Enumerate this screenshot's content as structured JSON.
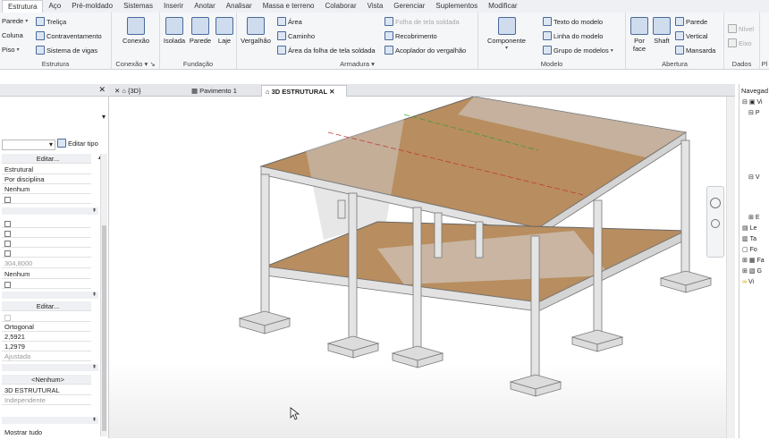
{
  "menu_tabs": [
    "Estrutura",
    "Aço",
    "Pré-moldado",
    "Sistemas",
    "Inserir",
    "Anotar",
    "Analisar",
    "Massa e terreno",
    "Colaborar",
    "Vista",
    "Gerenciar",
    "Suplementos",
    "Modificar"
  ],
  "ribbon": {
    "estrutura": {
      "label": "Estrutura",
      "parede": "Parede",
      "trelica": "Treliça",
      "coluna": "Coluna",
      "contraventamento": "Contraventamento",
      "piso": "Piso",
      "sistema_vigas": "Sistema de vigas"
    },
    "conexao": {
      "label": "Conexão",
      "btn": "Conexão"
    },
    "fundacao": {
      "label": "Fundação",
      "isolada": "Isolada",
      "parede": "Parede",
      "laje": "Laje"
    },
    "armadura": {
      "label": "Armadura",
      "vergalhao": "Vergalhão",
      "area": "Área",
      "caminho": "Caminho",
      "area_folha": "Área  da folha de tela soldada",
      "folha_tela": "Folha de tela soldada",
      "recobrimento": "Recobrimento",
      "acoplador": "Acoplador do  vergalhão"
    },
    "modelo": {
      "label": "Modelo",
      "componente": "Componente",
      "texto_modelo": "Texto do modelo",
      "linha_modelo": "Linha do modelo",
      "grupo_modelos": "Grupo de modelos"
    },
    "abertura": {
      "label": "Abertura",
      "por_face": "Por face",
      "shaft": "Shaft",
      "parede": "Parede",
      "vertical": "Vertical",
      "mansarda": "Mansarda"
    },
    "dados": {
      "label": "Dados",
      "nivel": "Nível",
      "eixo": "Eixo"
    },
    "extra": "Pl"
  },
  "properties": {
    "editar_tipo": "Editar tipo",
    "editar_1": "Editar...",
    "rows_a": [
      "Estrutural",
      "Por disciplina",
      "Nenhum"
    ],
    "value_304": "304,8000",
    "nenhum": "Nenhum",
    "editar_2": "Editar...",
    "rows_c": [
      "Ortogonal",
      "2,5921",
      "1,2979",
      "Ajustada"
    ],
    "nenhum_header": "<Nenhum>",
    "view_name": "3D ESTRUTURAL",
    "independente": "Independente",
    "mostrar_tudo": "Mostrar tudo"
  },
  "view_tabs": [
    {
      "label": "{3D}"
    },
    {
      "label": "Pavimento 1"
    },
    {
      "label": "3D ESTRUTURAL",
      "active": true
    }
  ],
  "navigator": {
    "title": "Navegad",
    "items": [
      "Vi",
      "P",
      "V",
      "E",
      "Le",
      "Ta",
      "Fo",
      "Fa",
      "G",
      "Vi"
    ]
  }
}
